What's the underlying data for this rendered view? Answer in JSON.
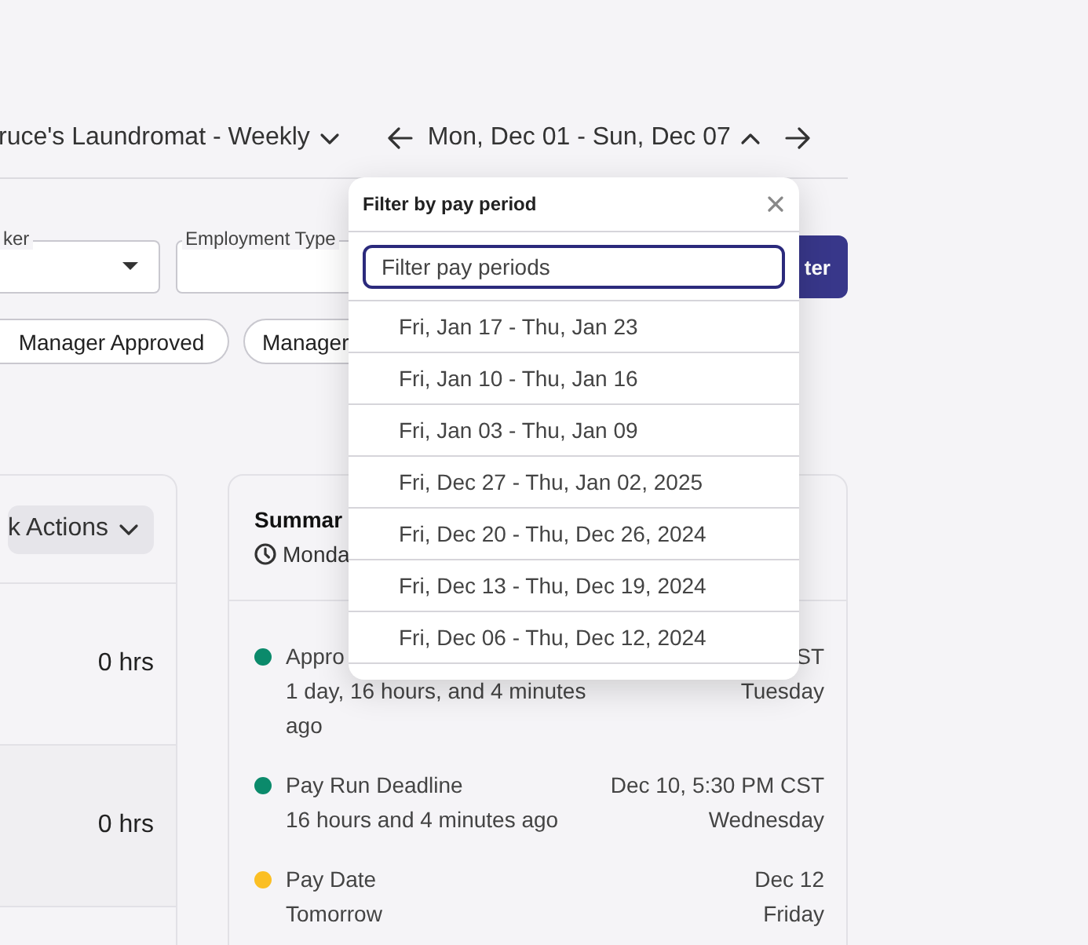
{
  "header": {
    "location": "ruce's Laundromat - Weekly",
    "period": "Mon, Dec 01 - Sun, Dec 07"
  },
  "filters": [
    {
      "label": "ker",
      "kind": "select"
    },
    {
      "label": "Employment Type",
      "kind": "text"
    }
  ],
  "filter_button": "ter",
  "chips": [
    {
      "label": "Manager Approved"
    },
    {
      "label": "Manager"
    }
  ],
  "bulk_actions": "k Actions",
  "rows": [
    {
      "hours": "0 hrs"
    },
    {
      "hours": "0 hrs"
    }
  ],
  "summary": {
    "title": "Summar",
    "subtitle": "Monda",
    "events": [
      {
        "title": "Appro",
        "detail": "1 day, 16 hours, and 4 minutes ago",
        "date": "ST",
        "day": "Tuesday",
        "color": "#0b8a6b"
      },
      {
        "title": "Pay Run Deadline",
        "detail": "16 hours and 4 minutes ago",
        "date": "Dec 10, 5:30 PM CST",
        "day": "Wednesday",
        "color": "#0b8a6b"
      },
      {
        "title": "Pay Date",
        "detail": "Tomorrow",
        "date": "Dec 12",
        "day": "Friday",
        "color": "#fbbf24"
      }
    ]
  },
  "popup": {
    "title": "Filter by pay period",
    "placeholder": "Filter pay periods",
    "periods": [
      "Fri, Jan 17 - Thu, Jan 23",
      "Fri, Jan 10 - Thu, Jan 16",
      "Fri, Jan 03 - Thu, Jan 09",
      "Fri, Dec 27 - Thu, Jan 02, 2025",
      "Fri, Dec 20 - Thu, Dec 26, 2024",
      "Fri, Dec 13 - Thu, Dec 19, 2024",
      "Fri, Dec 06 - Thu, Dec 12, 2024"
    ]
  }
}
